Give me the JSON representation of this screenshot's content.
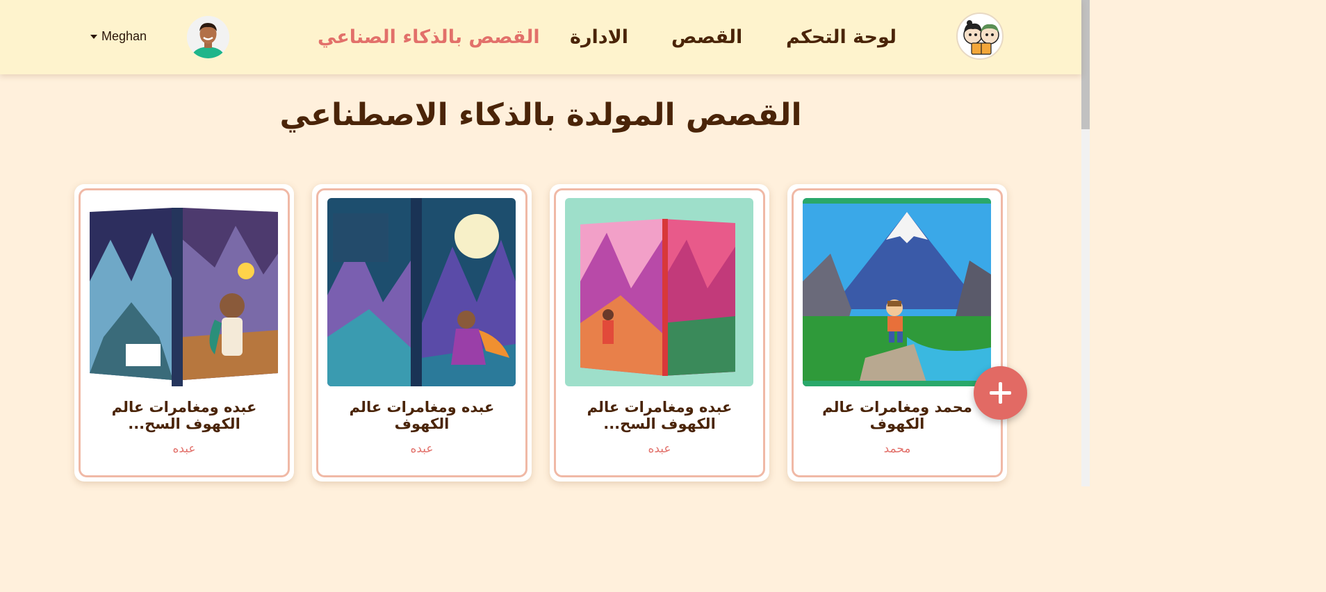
{
  "header": {
    "nav": [
      {
        "label": "لوحة التحكم"
      },
      {
        "label": "القصص"
      },
      {
        "label": "الادارة"
      },
      {
        "label": "القصص بالذكاء الصناعي",
        "active": true
      }
    ],
    "user_name": "Meghan"
  },
  "page_title": "القصص المولدة بالذكاء الاصطناعي",
  "stories": [
    {
      "title": "عبده ومغامرات عالم الكهوف السح...",
      "author": "عبده"
    },
    {
      "title": "عبده ومغامرات عالم الكهوف",
      "author": "عبده"
    },
    {
      "title": "عبده ومغامرات عالم الكهوف السح...",
      "author": "عبده"
    },
    {
      "title": "محمد ومغامرات عالم الكهوف",
      "author": "محمد"
    }
  ],
  "colors": {
    "accent": "#e2706a",
    "brown": "#4a2408",
    "header_bg": "#fef3cd",
    "page_bg": "#fff0dc"
  }
}
